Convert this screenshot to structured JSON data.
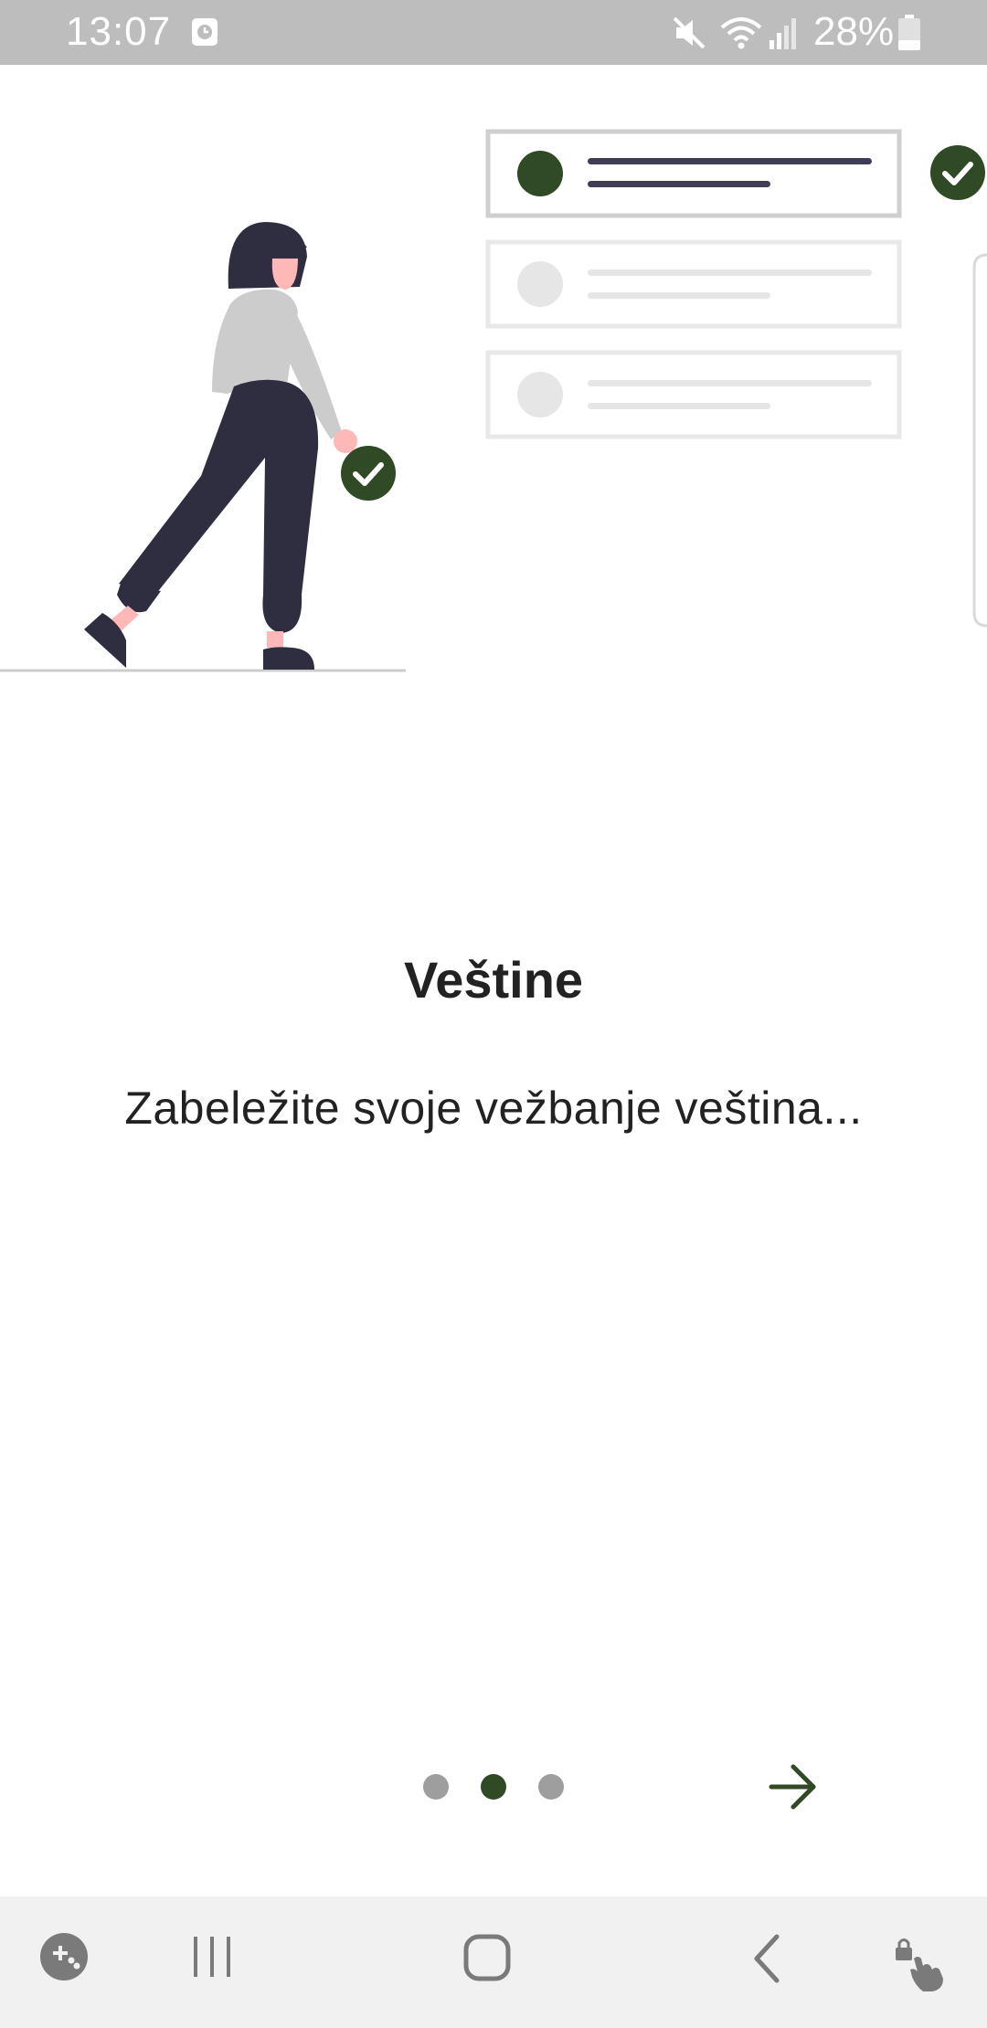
{
  "status_bar": {
    "time": "13:07",
    "battery": "28%",
    "icons": [
      "clock-icon",
      "mute-icon",
      "wifi-icon",
      "signal-icon",
      "battery-icon"
    ]
  },
  "slide": {
    "title": "Veštine",
    "description": "Zabeležite svoje vežbanje veština...",
    "current_page": 2,
    "total_pages": 3
  },
  "colors": {
    "accent": "#2f4a24",
    "dot_inactive": "#9e9e9e",
    "dark_figure": "#2f2e41",
    "status_bar": "#bdbdbd",
    "nav_bar": "#f1f1f1"
  },
  "navigation": {
    "next_icon": "arrow-right-icon",
    "nav_icons": [
      "game-launcher-icon",
      "recents-icon",
      "home-icon",
      "back-icon",
      "touch-lock-icon"
    ]
  }
}
